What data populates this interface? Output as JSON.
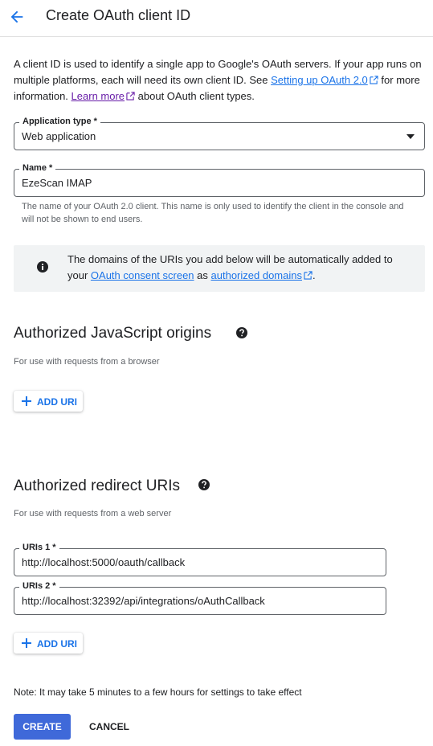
{
  "header": {
    "title": "Create OAuth client ID"
  },
  "intro": {
    "text1": "A client ID is used to identify a single app to Google's OAuth servers. If your app runs on multiple platforms, each will need its own client ID. See ",
    "link1": "Setting up OAuth 2.0",
    "text2": " for more information. ",
    "link2": "Learn more",
    "text3": " about OAuth client types."
  },
  "application_type": {
    "label": "Application type *",
    "value": "Web application"
  },
  "name_field": {
    "label": "Name *",
    "value": "EzeScan IMAP",
    "hint": "The name of your OAuth 2.0 client. This name is only used to identify the client in the console and will not be shown to end users."
  },
  "info": {
    "text1": "The domains of the URIs you add below will be automatically added to your ",
    "link1": "OAuth consent screen",
    "text2": " as ",
    "link2": "authorized domains",
    "text3": "."
  },
  "js_origins": {
    "title": "Authorized JavaScript origins",
    "subtitle": "For use with requests from a browser",
    "add_label": "ADD URI"
  },
  "redirect_uris": {
    "title": "Authorized redirect URIs",
    "subtitle": "For use with requests from a web server",
    "items": [
      {
        "label": "URIs 1 *",
        "value": "http://localhost:5000/oauth/callback"
      },
      {
        "label": "URIs 2 *",
        "value": "http://localhost:32392/api/integrations/oAuthCallback"
      }
    ],
    "add_label": "ADD URI"
  },
  "footer": {
    "note": "Note: It may take 5 minutes to a few hours for settings to take effect",
    "create_label": "CREATE",
    "cancel_label": "CANCEL"
  },
  "colors": {
    "primary": "#1a73e8",
    "create_button": "#3f69d9",
    "info_bg": "#f1f3f4"
  }
}
